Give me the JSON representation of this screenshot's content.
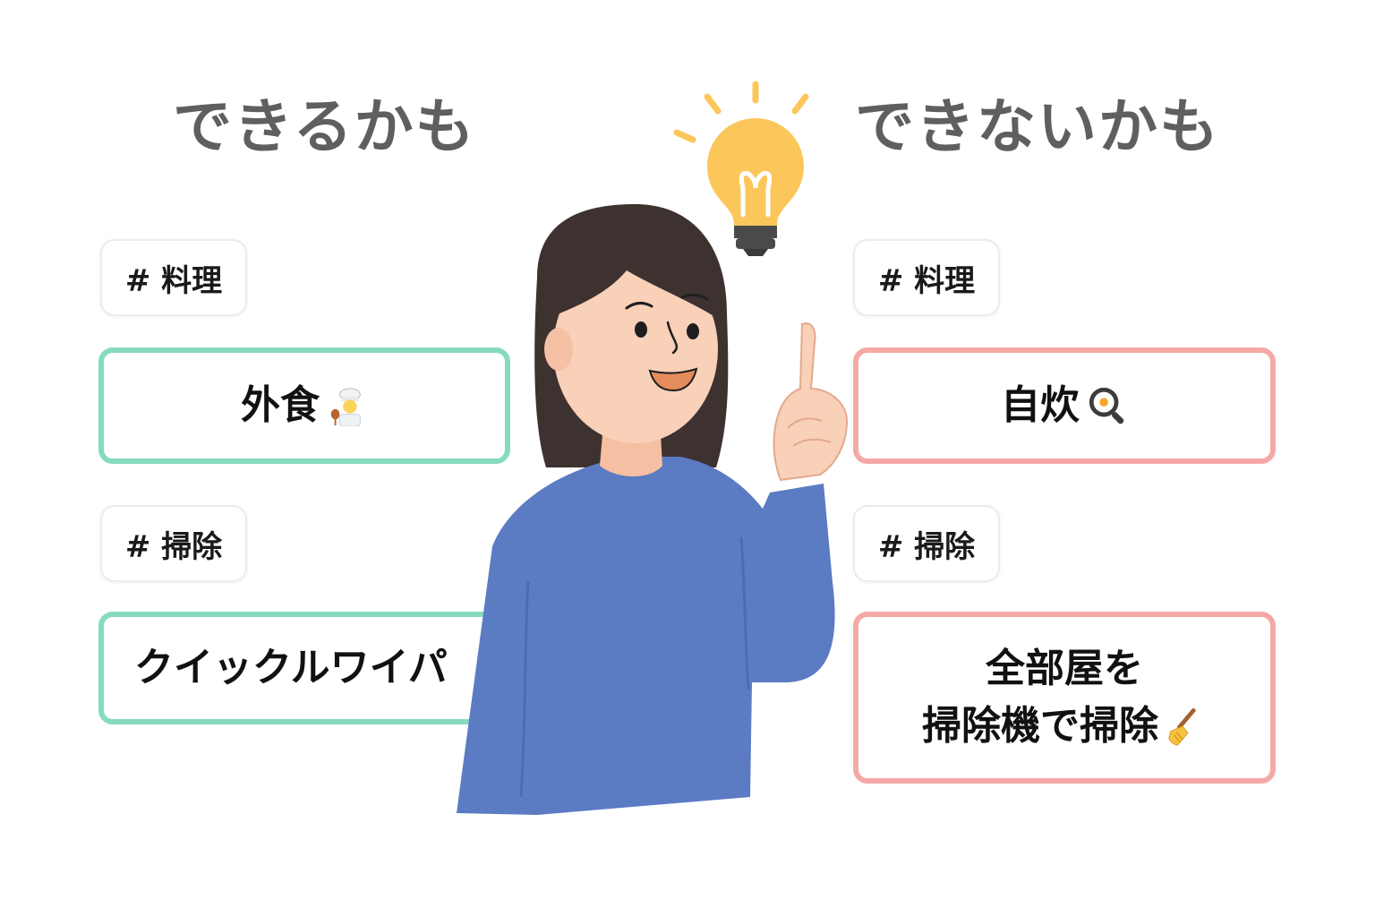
{
  "left": {
    "heading": "できるかも",
    "sections": [
      {
        "tag": "# 料理",
        "card_text": "外食",
        "icon": "chef-emoji-icon",
        "accent": "#86dbbd"
      },
      {
        "tag": "# 掃除",
        "card_text": "クイックルワイパ",
        "icon": "",
        "accent": "#86dbbd"
      }
    ]
  },
  "right": {
    "heading": "できないかも",
    "sections": [
      {
        "tag": "# 料理",
        "card_text": "自炊",
        "icon": "frying-pan-egg-icon",
        "accent": "#f5a9a6"
      },
      {
        "tag": "# 掃除",
        "card_line1": "全部屋を",
        "card_line2": "掃除機で掃除",
        "icon": "broom-icon",
        "accent": "#f5a9a6"
      }
    ]
  },
  "illustration": {
    "figure": "woman-pointing-up",
    "idea_icon": "lightbulb-icon",
    "colors": {
      "sweater": "#5b7bc2",
      "hair": "#3d3230",
      "skin": "#f9d0b8",
      "bulb": "#fcc75a"
    }
  }
}
